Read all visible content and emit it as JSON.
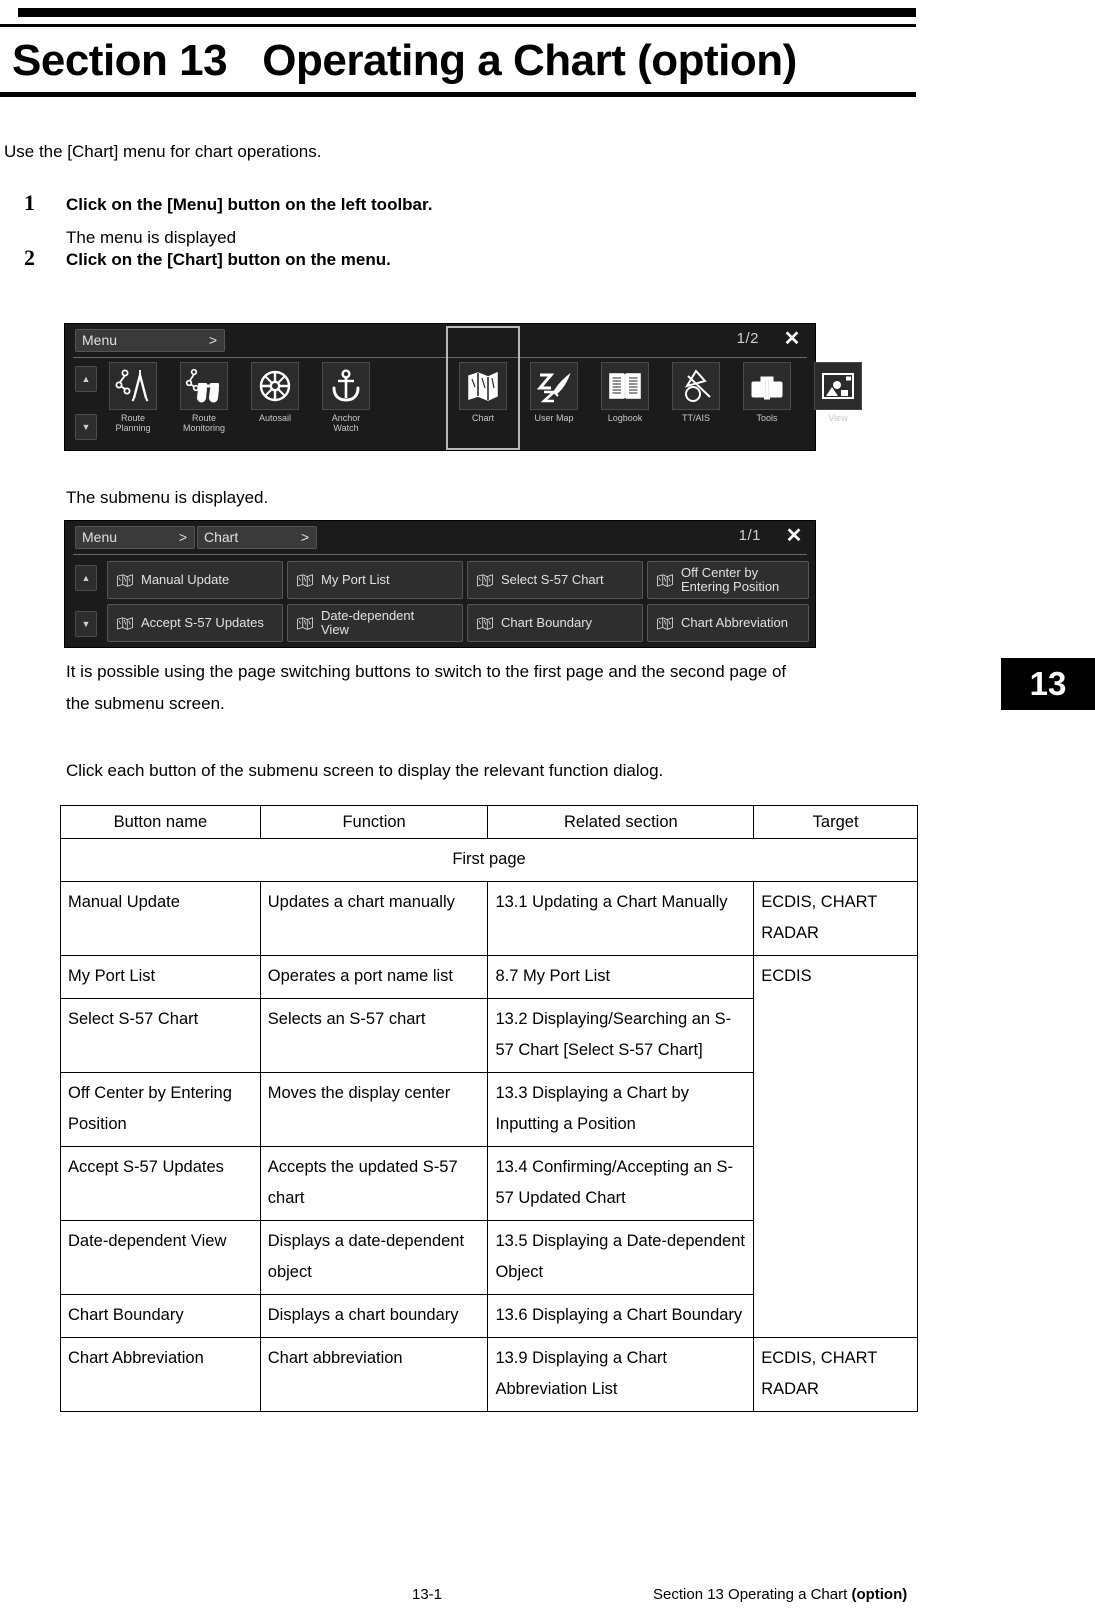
{
  "section": {
    "title": "Section 13   Operating a Chart (option)"
  },
  "intro": "Use the [Chart] menu for chart operations.",
  "steps": [
    {
      "num": "1",
      "title": "Click on the [Menu] button on the left toolbar.",
      "sub": "The menu is displayed"
    },
    {
      "num": "2",
      "title": "Click on the [Chart] button on the menu.",
      "sub": "The submenu is displayed."
    }
  ],
  "menu_screenshot": {
    "breadcrumb_label": "Menu",
    "breadcrumb_arrow": ">",
    "page_indicator": "1/2",
    "close_icon": "✕",
    "scroll_up": "▲",
    "scroll_down": "▼",
    "items": [
      {
        "caption": "Route\nPlanning",
        "icon": "dividers-icon"
      },
      {
        "caption": "Route\nMonitoring",
        "icon": "binoculars-icon"
      },
      {
        "caption": "Autosail",
        "icon": "ships-wheel-icon"
      },
      {
        "caption": "Anchor\nWatch",
        "icon": "anchor-icon"
      },
      {
        "caption": "Chart",
        "icon": "folded-map-icon"
      },
      {
        "caption": "User Map",
        "icon": "user-map-icon"
      },
      {
        "caption": "Logbook",
        "icon": "open-book-icon"
      },
      {
        "caption": "TT/AIS",
        "icon": "tt-ais-icon"
      },
      {
        "caption": "Tools",
        "icon": "toolbox-icon"
      },
      {
        "caption": "View",
        "icon": "view-icon"
      }
    ],
    "selected_item": "Chart"
  },
  "submenu_screenshot": {
    "breadcrumb_menu": "Menu",
    "breadcrumb_chart": "Chart",
    "breadcrumb_arrow": ">",
    "page_indicator": "1/1",
    "close_icon": "✕",
    "scroll_up": "▲",
    "scroll_down": "▼",
    "buttons": [
      {
        "label": "Manual Update",
        "icon": "folded-map-icon"
      },
      {
        "label": "My Port List",
        "icon": "folded-map-icon"
      },
      {
        "label": "Select S-57 Chart",
        "icon": "folded-map-icon"
      },
      {
        "label": "Off Center by\nEntering Position",
        "icon": "folded-map-icon"
      },
      {
        "label": "Accept S-57 Updates",
        "icon": "folded-map-icon"
      },
      {
        "label": "Date-dependent\nView",
        "icon": "folded-map-icon"
      },
      {
        "label": "Chart Boundary",
        "icon": "folded-map-icon"
      },
      {
        "label": "Chart Abbreviation",
        "icon": "folded-map-icon"
      }
    ]
  },
  "paragraphs": {
    "page_switching": "It is possible using the page switching buttons to switch to the first page and the second page of\nthe submenu screen.",
    "click_each": "Click each button of the submenu screen to display the relevant function dialog."
  },
  "table": {
    "headers": [
      "Button name",
      "Function",
      "Related section",
      "Target"
    ],
    "group_row": "First page",
    "rows": [
      {
        "button_name": "Manual Update",
        "function": "Updates a chart manually",
        "related_section": "13.1 Updating a Chart Manually",
        "target": "ECDIS, CHART RADAR"
      },
      {
        "button_name": "My Port List",
        "function": "Operates a port name list",
        "related_section": "8.7 My Port List",
        "target": "ECDIS"
      },
      {
        "button_name": "Select S-57 Chart",
        "function": "Selects an S-57 chart",
        "related_section": "13.2 Displaying/Searching an S-57 Chart [Select S-57 Chart]",
        "target": ""
      },
      {
        "button_name": "Off Center by Entering Position",
        "function": "Moves the display center",
        "related_section": "13.3 Displaying a Chart by Inputting a Position",
        "target": ""
      },
      {
        "button_name": "Accept S-57 Updates",
        "function": "Accepts the updated S-57 chart",
        "related_section": "13.4 Confirming/Accepting an S-57 Updated Chart",
        "target": ""
      },
      {
        "button_name": "Date-dependent View",
        "function": "Displays a date-dependent object",
        "related_section": "13.5 Displaying a Date-dependent Object",
        "target": ""
      },
      {
        "button_name": "Chart Boundary",
        "function": "Displays a chart boundary",
        "related_section": "13.6 Displaying a Chart Boundary",
        "target": ""
      },
      {
        "button_name": "Chart Abbreviation",
        "function": "Chart abbreviation",
        "related_section": "13.9 Displaying a Chart Abbreviation List",
        "target": "ECDIS, CHART RADAR"
      }
    ]
  },
  "side_tab": "13",
  "footer": {
    "page_number": "13-1",
    "section_plain": "Section 13   Operating a Chart ",
    "section_bold": "(option)"
  }
}
